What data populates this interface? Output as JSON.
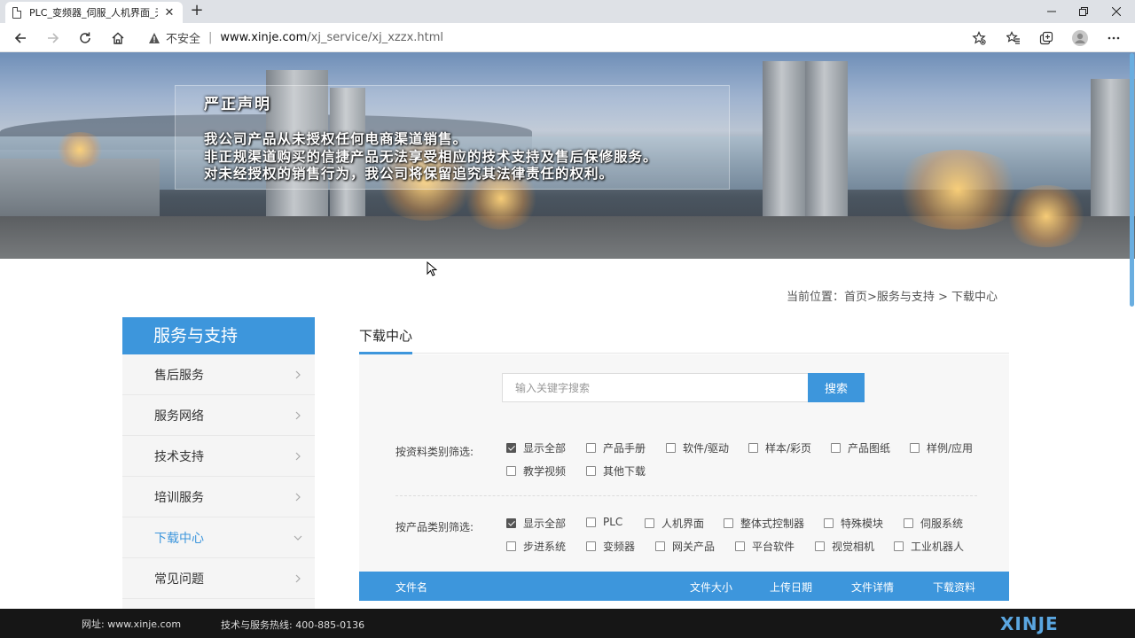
{
  "browser": {
    "tab_title": "PLC_变频器_伺服_人机界面_无锡",
    "insecure_label": "不安全",
    "url_host": "www.xinje.com",
    "url_path": "/xj_service/xj_xzzx.html"
  },
  "banner": {
    "notice_title": "严正声明",
    "notice_lines": [
      "我公司产品从未授权任何电商渠道销售。",
      "非正规渠道购买的信捷产品无法享受相应的技术支持及售后保修服务。",
      "对未经授权的销售行为，我公司将保留追究其法律责任的权利。"
    ]
  },
  "breadcrumb": "当前位置：首页>服务与支持 > 下载中心",
  "sidebar": {
    "title": "服务与支持",
    "items": [
      {
        "label": "售后服务"
      },
      {
        "label": "服务网络"
      },
      {
        "label": "技术支持"
      },
      {
        "label": "培训服务"
      },
      {
        "label": "下载中心"
      },
      {
        "label": "常见问题"
      }
    ]
  },
  "main": {
    "title": "下载中心",
    "search": {
      "placeholder": "输入关键字搜索",
      "button": "搜索"
    },
    "filter_type": {
      "label": "按资料类别筛选:",
      "options": [
        {
          "label": "显示全部",
          "checked": true
        },
        {
          "label": "产品手册",
          "checked": false
        },
        {
          "label": "软件/驱动",
          "checked": false
        },
        {
          "label": "样本/彩页",
          "checked": false
        },
        {
          "label": "产品图纸",
          "checked": false
        },
        {
          "label": "样例/应用",
          "checked": false
        },
        {
          "label": "教学视频",
          "checked": false
        },
        {
          "label": "其他下载",
          "checked": false
        }
      ]
    },
    "filter_product": {
      "label": "按产品类别筛选:",
      "options": [
        {
          "label": "显示全部",
          "checked": true
        },
        {
          "label": "PLC",
          "checked": false
        },
        {
          "label": "人机界面",
          "checked": false
        },
        {
          "label": "整体式控制器",
          "checked": false
        },
        {
          "label": "特殊模块",
          "checked": false
        },
        {
          "label": "伺服系统",
          "checked": false
        },
        {
          "label": "步进系统",
          "checked": false
        },
        {
          "label": "变频器",
          "checked": false
        },
        {
          "label": "网关产品",
          "checked": false
        },
        {
          "label": "平台软件",
          "checked": false
        },
        {
          "label": "视觉相机",
          "checked": false
        },
        {
          "label": "工业机器人",
          "checked": false
        }
      ]
    },
    "table_headers": [
      "文件名",
      "文件大小",
      "上传日期",
      "文件详情",
      "下载资料"
    ]
  },
  "footer": {
    "website": "网址:  www.xinje.com",
    "hotline": "技术与服务热线: 400-885-0136",
    "logo": "XINJE"
  }
}
